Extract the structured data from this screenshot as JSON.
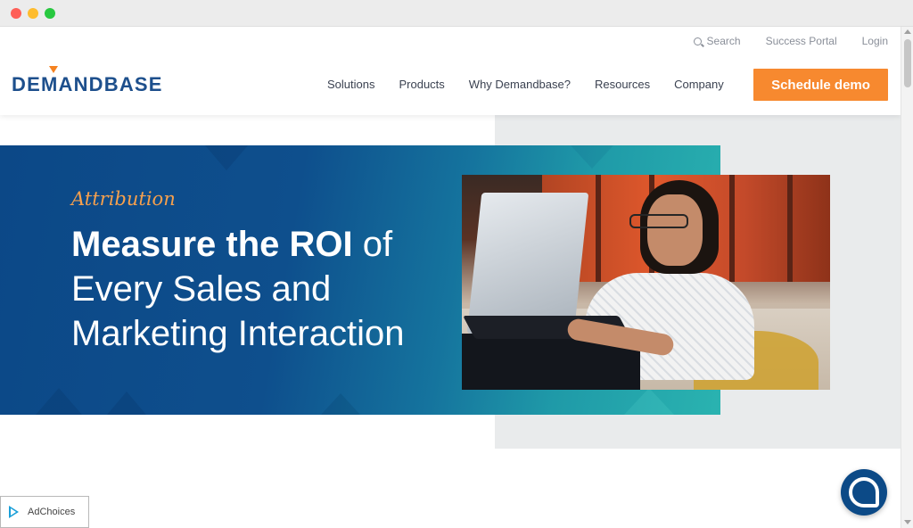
{
  "header": {
    "utility": {
      "search_label": "Search",
      "success_portal": "Success Portal",
      "login": "Login"
    },
    "logo_text": "DEMANDBASE",
    "nav": [
      "Solutions",
      "Products",
      "Why Demandbase?",
      "Resources",
      "Company"
    ],
    "cta_label": "Schedule demo"
  },
  "hero": {
    "eyebrow": "Attribution",
    "headline_bold": "Measure the ROI",
    "headline_rest": " of Every Sales and Marketing Interaction"
  },
  "ad_choices": "AdChoices",
  "colors": {
    "brand_blue": "#1d4f8c",
    "accent_orange": "#f7892f",
    "eyebrow_orange": "#f6a04d",
    "hero_teal": "#2ab3b0"
  }
}
